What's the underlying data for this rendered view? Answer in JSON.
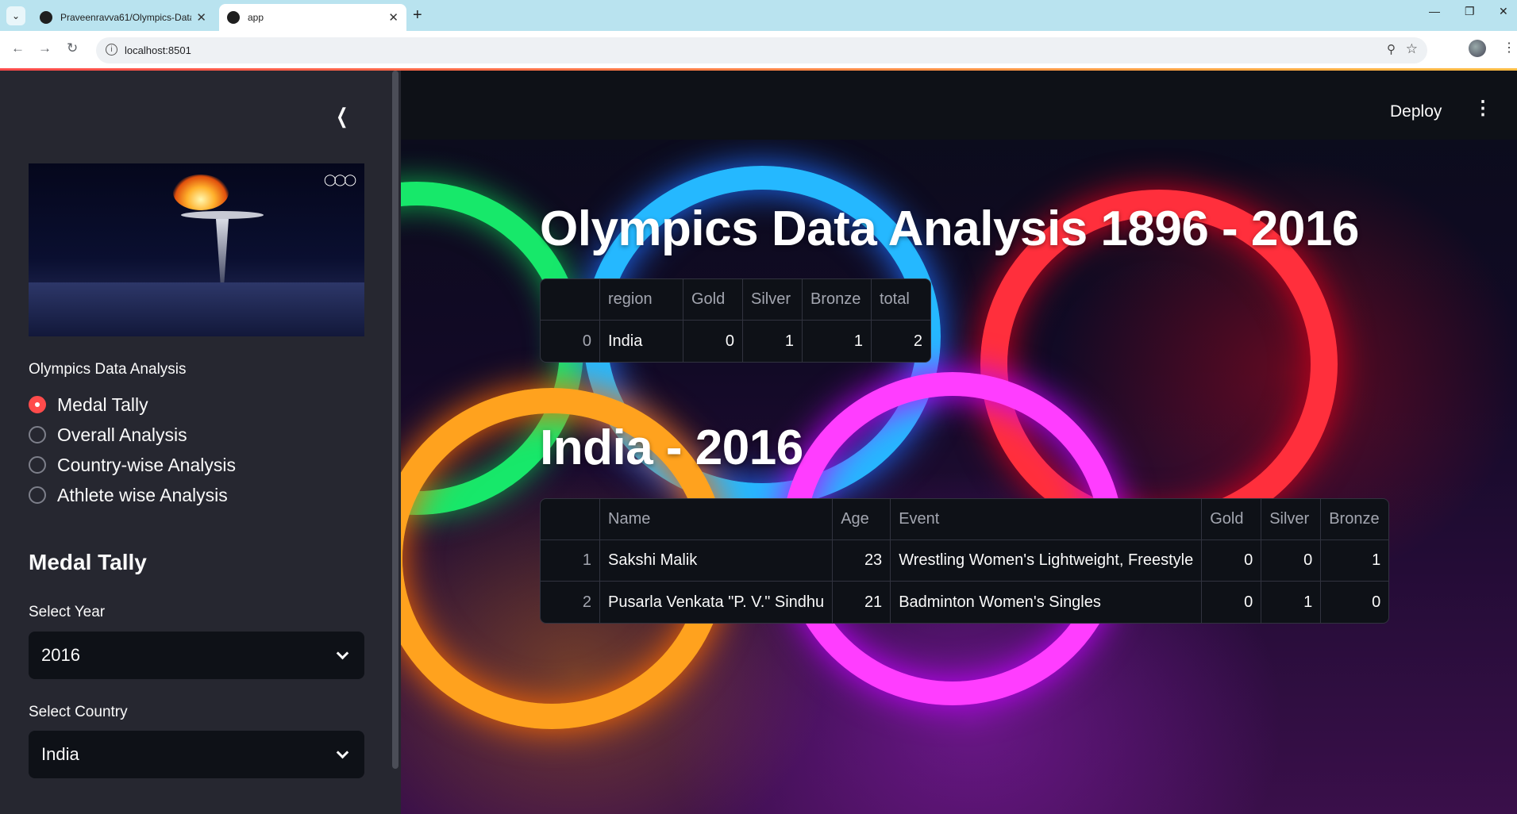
{
  "browser": {
    "tabs": [
      {
        "title": "Praveenravva61/Olympics-Data",
        "active": false
      },
      {
        "title": "app",
        "active": true
      }
    ],
    "url": "localhost:8501"
  },
  "sidebar": {
    "nav_label": "Olympics Data Analysis",
    "options": [
      "Medal Tally",
      "Overall Analysis",
      "Country-wise Analysis",
      "Athlete wise Analysis"
    ],
    "selected": "Medal Tally",
    "heading": "Medal Tally",
    "year": {
      "label": "Select Year",
      "value": "2016"
    },
    "country": {
      "label": "Select Country",
      "value": "India"
    }
  },
  "header": {
    "deploy_label": "Deploy"
  },
  "main": {
    "title": "Olympics Data Analysis 1896 - 2016",
    "tally_table": {
      "columns": [
        "",
        "region",
        "Gold",
        "Silver",
        "Bronze",
        "total"
      ],
      "rows": [
        [
          "0",
          "India",
          "0",
          "1",
          "1",
          "2"
        ]
      ]
    },
    "subtitle": "India - 2016",
    "athlete_table": {
      "columns": [
        "",
        "Name",
        "Age",
        "Event",
        "Gold",
        "Silver",
        "Bronze"
      ],
      "rows": [
        [
          "1",
          "Sakshi Malik",
          "23",
          "Wrestling Women's Lightweight, Freestyle",
          "0",
          "0",
          "1"
        ],
        [
          "2",
          "Pusarla Venkata \"P. V.\" Sindhu",
          "21",
          "Badminton Women's Singles",
          "0",
          "1",
          "0"
        ]
      ]
    }
  },
  "colors": {
    "accent": "#ff4b4b",
    "sidebar_bg": "#262730",
    "app_bg": "#0e1117"
  }
}
